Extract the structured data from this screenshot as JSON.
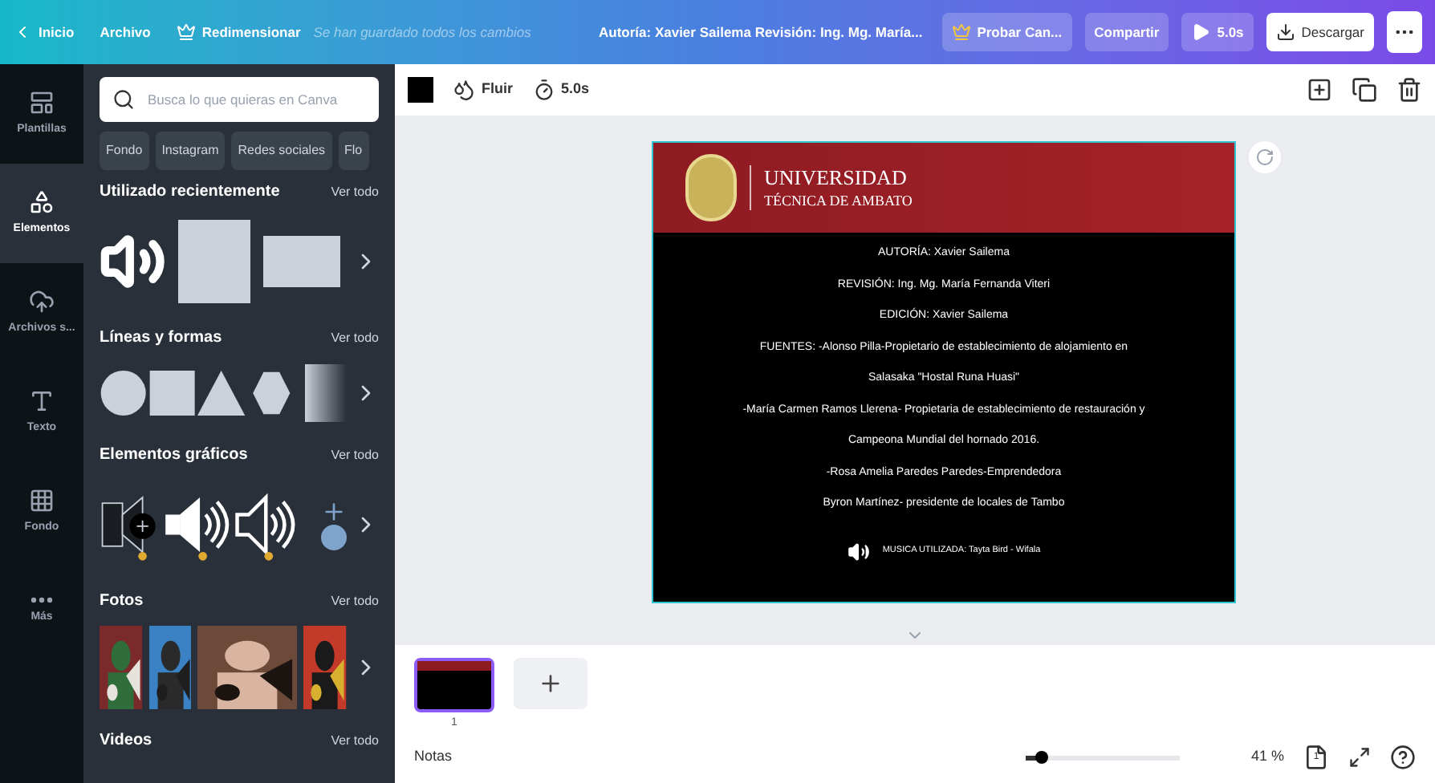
{
  "top_bar": {
    "back": "Inicio",
    "menu": [
      "Archivo",
      "Redimensionar"
    ],
    "save_status": "Se han guardado todos los cambios",
    "design_title": "Autoría: Xavier Sailema Revisión: Ing. Mg. María...",
    "try_button": "Probar Can...",
    "share_button": "Compartir",
    "play_button": "5.0s",
    "download_button": "Descargar"
  },
  "rail": [
    {
      "label": "Plantillas",
      "selected": false
    },
    {
      "label": "Elementos",
      "selected": true
    },
    {
      "label": "Archivos s...",
      "selected": false
    },
    {
      "label": "Texto",
      "selected": false
    },
    {
      "label": "Fondo",
      "selected": false
    },
    {
      "label": "Más",
      "selected": false
    }
  ],
  "panel": {
    "search": {
      "placeholder": "Busca lo que quieras en Canva"
    },
    "chips": [
      "Fondo",
      "Instagram",
      "Redes sociales",
      "Flo"
    ],
    "sections": [
      {
        "title": "Utilizado recientemente",
        "link": "Ver todo",
        "kind": "recent"
      },
      {
        "title": "Líneas y formas",
        "link": "Ver todo",
        "kind": "shapes"
      },
      {
        "title": "Elementos gráficos",
        "link": "Ver todo",
        "kind": "graphics"
      },
      {
        "title": "Fotos",
        "link": "Ver todo",
        "kind": "photos"
      },
      {
        "title": "Videos",
        "link": "Ver todo",
        "kind": "none"
      }
    ]
  },
  "toolbar": {
    "animation": "Fluir",
    "duration": "5.0s"
  },
  "slide": {
    "logo_line1": "UNIVERSIDAD",
    "logo_line2": "TÉCNICA DE AMBATO",
    "lines": [
      "AUTORÍA: Xavier Sailema",
      "REVISIÓN: Ing. Mg. María Fernanda Viteri",
      "EDICIÓN: Xavier Sailema",
      "FUENTES: -Alonso Pilla-Propietario de establecimiento de alojamiento en",
      "Salasaka \"Hostal Runa Huasi\"",
      "-María Carmen Ramos Llerena- Propietaria de establecimiento de restauración y",
      "Campeona Mundial del hornado 2016.",
      "-Rosa Amelia Paredes Paredes-Emprendedora",
      "Byron Martínez- presidente de locales de Tambo"
    ],
    "music": "MUSICA UTILIZADA: Tayta Bird - Wifala"
  },
  "pages": [
    {
      "number": "1",
      "selected": true
    }
  ],
  "footer": {
    "notes": "Notas",
    "zoom": {
      "level": 0.1
    },
    "zoom_reading": "41 %",
    "page_count": "1"
  }
}
